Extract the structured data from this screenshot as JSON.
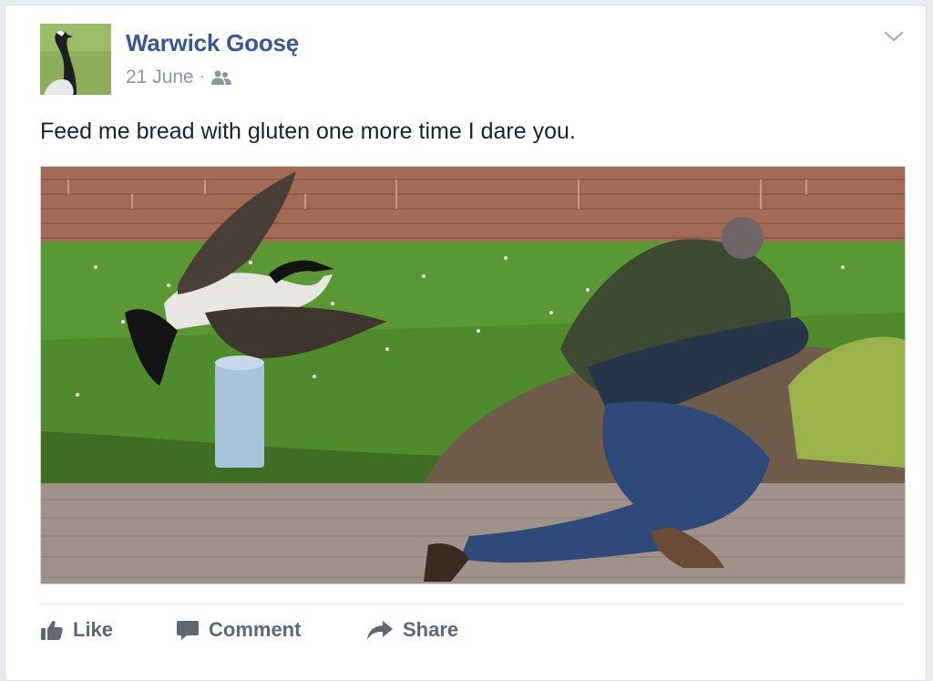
{
  "post": {
    "author": "Warwick Goosę",
    "date": "21 June",
    "separator": "·",
    "text": "Feed me bread with gluten one more time I dare you."
  },
  "actions": {
    "like": "Like",
    "comment": "Comment",
    "share": "Share"
  },
  "icons": {
    "audience": "friends-icon",
    "menu": "chevron-down-icon",
    "like": "thumbs-up-icon",
    "comment": "speech-bubble-icon",
    "share": "share-arrow-icon"
  },
  "colors": {
    "author_link": "#365899",
    "meta_text": "#90949c",
    "action_text": "#606770",
    "body_text": "#1d2129"
  }
}
